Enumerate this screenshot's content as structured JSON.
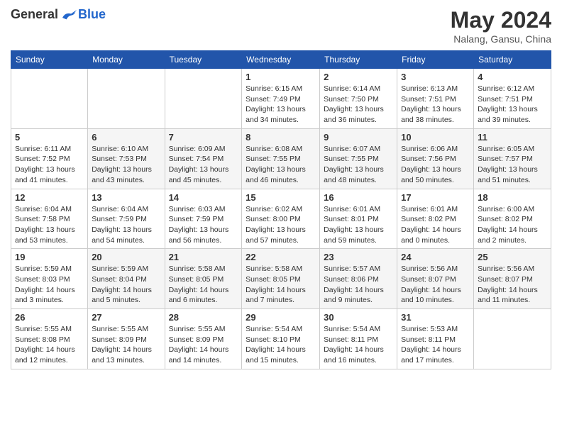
{
  "logo": {
    "general": "General",
    "blue": "Blue"
  },
  "title": "May 2024",
  "location": "Nalang, Gansu, China",
  "days_header": [
    "Sunday",
    "Monday",
    "Tuesday",
    "Wednesday",
    "Thursday",
    "Friday",
    "Saturday"
  ],
  "weeks": [
    [
      {
        "day": "",
        "sunrise": "",
        "sunset": "",
        "daylight": ""
      },
      {
        "day": "",
        "sunrise": "",
        "sunset": "",
        "daylight": ""
      },
      {
        "day": "",
        "sunrise": "",
        "sunset": "",
        "daylight": ""
      },
      {
        "day": "1",
        "sunrise": "Sunrise: 6:15 AM",
        "sunset": "Sunset: 7:49 PM",
        "daylight": "Daylight: 13 hours and 34 minutes."
      },
      {
        "day": "2",
        "sunrise": "Sunrise: 6:14 AM",
        "sunset": "Sunset: 7:50 PM",
        "daylight": "Daylight: 13 hours and 36 minutes."
      },
      {
        "day": "3",
        "sunrise": "Sunrise: 6:13 AM",
        "sunset": "Sunset: 7:51 PM",
        "daylight": "Daylight: 13 hours and 38 minutes."
      },
      {
        "day": "4",
        "sunrise": "Sunrise: 6:12 AM",
        "sunset": "Sunset: 7:51 PM",
        "daylight": "Daylight: 13 hours and 39 minutes."
      }
    ],
    [
      {
        "day": "5",
        "sunrise": "Sunrise: 6:11 AM",
        "sunset": "Sunset: 7:52 PM",
        "daylight": "Daylight: 13 hours and 41 minutes."
      },
      {
        "day": "6",
        "sunrise": "Sunrise: 6:10 AM",
        "sunset": "Sunset: 7:53 PM",
        "daylight": "Daylight: 13 hours and 43 minutes."
      },
      {
        "day": "7",
        "sunrise": "Sunrise: 6:09 AM",
        "sunset": "Sunset: 7:54 PM",
        "daylight": "Daylight: 13 hours and 45 minutes."
      },
      {
        "day": "8",
        "sunrise": "Sunrise: 6:08 AM",
        "sunset": "Sunset: 7:55 PM",
        "daylight": "Daylight: 13 hours and 46 minutes."
      },
      {
        "day": "9",
        "sunrise": "Sunrise: 6:07 AM",
        "sunset": "Sunset: 7:55 PM",
        "daylight": "Daylight: 13 hours and 48 minutes."
      },
      {
        "day": "10",
        "sunrise": "Sunrise: 6:06 AM",
        "sunset": "Sunset: 7:56 PM",
        "daylight": "Daylight: 13 hours and 50 minutes."
      },
      {
        "day": "11",
        "sunrise": "Sunrise: 6:05 AM",
        "sunset": "Sunset: 7:57 PM",
        "daylight": "Daylight: 13 hours and 51 minutes."
      }
    ],
    [
      {
        "day": "12",
        "sunrise": "Sunrise: 6:04 AM",
        "sunset": "Sunset: 7:58 PM",
        "daylight": "Daylight: 13 hours and 53 minutes."
      },
      {
        "day": "13",
        "sunrise": "Sunrise: 6:04 AM",
        "sunset": "Sunset: 7:59 PM",
        "daylight": "Daylight: 13 hours and 54 minutes."
      },
      {
        "day": "14",
        "sunrise": "Sunrise: 6:03 AM",
        "sunset": "Sunset: 7:59 PM",
        "daylight": "Daylight: 13 hours and 56 minutes."
      },
      {
        "day": "15",
        "sunrise": "Sunrise: 6:02 AM",
        "sunset": "Sunset: 8:00 PM",
        "daylight": "Daylight: 13 hours and 57 minutes."
      },
      {
        "day": "16",
        "sunrise": "Sunrise: 6:01 AM",
        "sunset": "Sunset: 8:01 PM",
        "daylight": "Daylight: 13 hours and 59 minutes."
      },
      {
        "day": "17",
        "sunrise": "Sunrise: 6:01 AM",
        "sunset": "Sunset: 8:02 PM",
        "daylight": "Daylight: 14 hours and 0 minutes."
      },
      {
        "day": "18",
        "sunrise": "Sunrise: 6:00 AM",
        "sunset": "Sunset: 8:02 PM",
        "daylight": "Daylight: 14 hours and 2 minutes."
      }
    ],
    [
      {
        "day": "19",
        "sunrise": "Sunrise: 5:59 AM",
        "sunset": "Sunset: 8:03 PM",
        "daylight": "Daylight: 14 hours and 3 minutes."
      },
      {
        "day": "20",
        "sunrise": "Sunrise: 5:59 AM",
        "sunset": "Sunset: 8:04 PM",
        "daylight": "Daylight: 14 hours and 5 minutes."
      },
      {
        "day": "21",
        "sunrise": "Sunrise: 5:58 AM",
        "sunset": "Sunset: 8:05 PM",
        "daylight": "Daylight: 14 hours and 6 minutes."
      },
      {
        "day": "22",
        "sunrise": "Sunrise: 5:58 AM",
        "sunset": "Sunset: 8:05 PM",
        "daylight": "Daylight: 14 hours and 7 minutes."
      },
      {
        "day": "23",
        "sunrise": "Sunrise: 5:57 AM",
        "sunset": "Sunset: 8:06 PM",
        "daylight": "Daylight: 14 hours and 9 minutes."
      },
      {
        "day": "24",
        "sunrise": "Sunrise: 5:56 AM",
        "sunset": "Sunset: 8:07 PM",
        "daylight": "Daylight: 14 hours and 10 minutes."
      },
      {
        "day": "25",
        "sunrise": "Sunrise: 5:56 AM",
        "sunset": "Sunset: 8:07 PM",
        "daylight": "Daylight: 14 hours and 11 minutes."
      }
    ],
    [
      {
        "day": "26",
        "sunrise": "Sunrise: 5:55 AM",
        "sunset": "Sunset: 8:08 PM",
        "daylight": "Daylight: 14 hours and 12 minutes."
      },
      {
        "day": "27",
        "sunrise": "Sunrise: 5:55 AM",
        "sunset": "Sunset: 8:09 PM",
        "daylight": "Daylight: 14 hours and 13 minutes."
      },
      {
        "day": "28",
        "sunrise": "Sunrise: 5:55 AM",
        "sunset": "Sunset: 8:09 PM",
        "daylight": "Daylight: 14 hours and 14 minutes."
      },
      {
        "day": "29",
        "sunrise": "Sunrise: 5:54 AM",
        "sunset": "Sunset: 8:10 PM",
        "daylight": "Daylight: 14 hours and 15 minutes."
      },
      {
        "day": "30",
        "sunrise": "Sunrise: 5:54 AM",
        "sunset": "Sunset: 8:11 PM",
        "daylight": "Daylight: 14 hours and 16 minutes."
      },
      {
        "day": "31",
        "sunrise": "Sunrise: 5:53 AM",
        "sunset": "Sunset: 8:11 PM",
        "daylight": "Daylight: 14 hours and 17 minutes."
      },
      {
        "day": "",
        "sunrise": "",
        "sunset": "",
        "daylight": ""
      }
    ]
  ]
}
